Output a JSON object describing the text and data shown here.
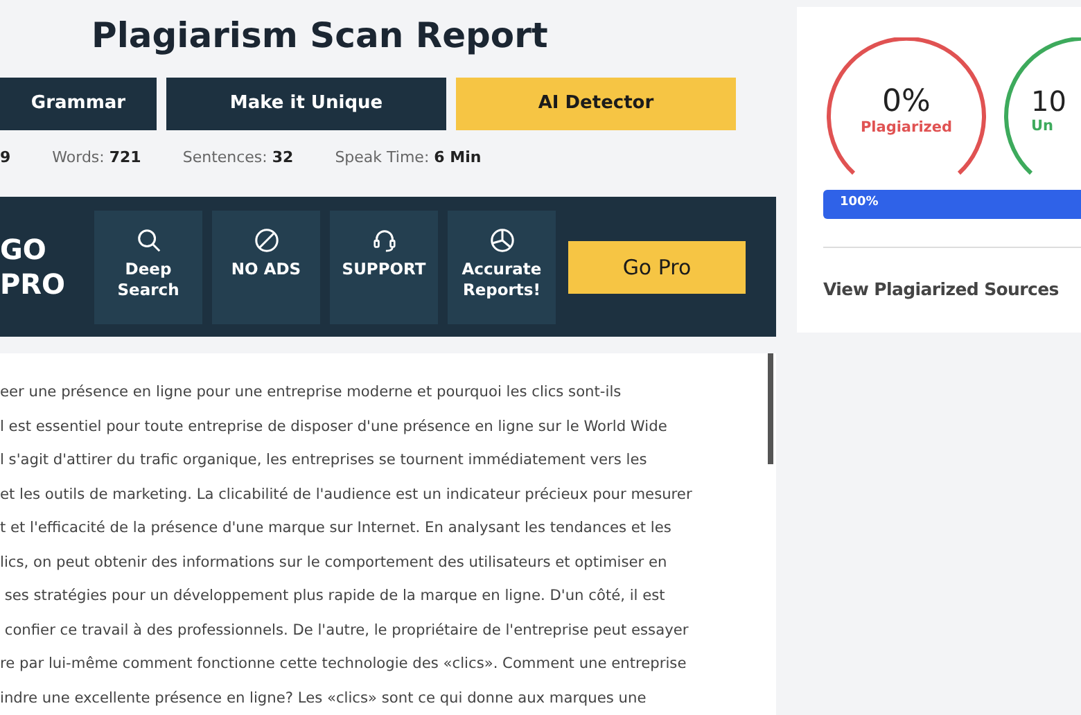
{
  "title": "Plagiarism Scan Report",
  "tools": [
    {
      "label": "Grammar",
      "selected": false
    },
    {
      "label": "Make it Unique",
      "selected": false
    },
    {
      "label": "AI Detector",
      "selected": true
    }
  ],
  "stats": [
    {
      "value": "9"
    },
    {
      "label": "Words:",
      "value": "721"
    },
    {
      "label": "Sentences:",
      "value": "32"
    },
    {
      "label": "Speak Time:",
      "value": "6 Min"
    }
  ],
  "promo": {
    "heading": [
      "GO",
      "PRO"
    ],
    "features": [
      {
        "kind": "search",
        "label": "Deep Search"
      },
      {
        "kind": "no-ads",
        "label": "NO ADS"
      },
      {
        "kind": "support",
        "label": "SUPPORT"
      },
      {
        "kind": "reports",
        "label": "Accurate Reports!"
      }
    ],
    "button": "Go Pro"
  },
  "text_lines": [
    "eer une présence en ligne pour une entreprise moderne et pourquoi les clics sont-ils",
    "l est essentiel pour toute entreprise de disposer d'une présence en ligne sur le World Wide",
    "l s'agit d'attirer du trafic organique, les entreprises se tournent immédiatement vers les",
    "et les outils de marketing. La clicabilité de l'audience est un indicateur précieux pour mesurer",
    "t et l'efficacité de la présence d'une marque sur Internet. En analysant les tendances et les",
    "lics, on peut obtenir des informations sur le comportement des utilisateurs et optimiser en",
    " ses stratégies pour un développement plus rapide de la marque en ligne. D'un côté, il est",
    " confier ce travail à des professionnels. De l'autre, le propriétaire de l'entreprise peut essayer",
    "re par lui-même comment fonctionne cette technologie des «clics». Comment une entreprise",
    "indre une excellente présence en ligne? Les «clics» sont ce qui donne aux marques une"
  ],
  "gauges": [
    {
      "value": "0%",
      "label": "Plagiarized",
      "color": "#e05252"
    },
    {
      "value": "10",
      "label": "Un",
      "color": "#3daa5c"
    }
  ],
  "progress": {
    "level": 1,
    "reading": "100%"
  },
  "sources_link": "View Plagiarized Sources"
}
